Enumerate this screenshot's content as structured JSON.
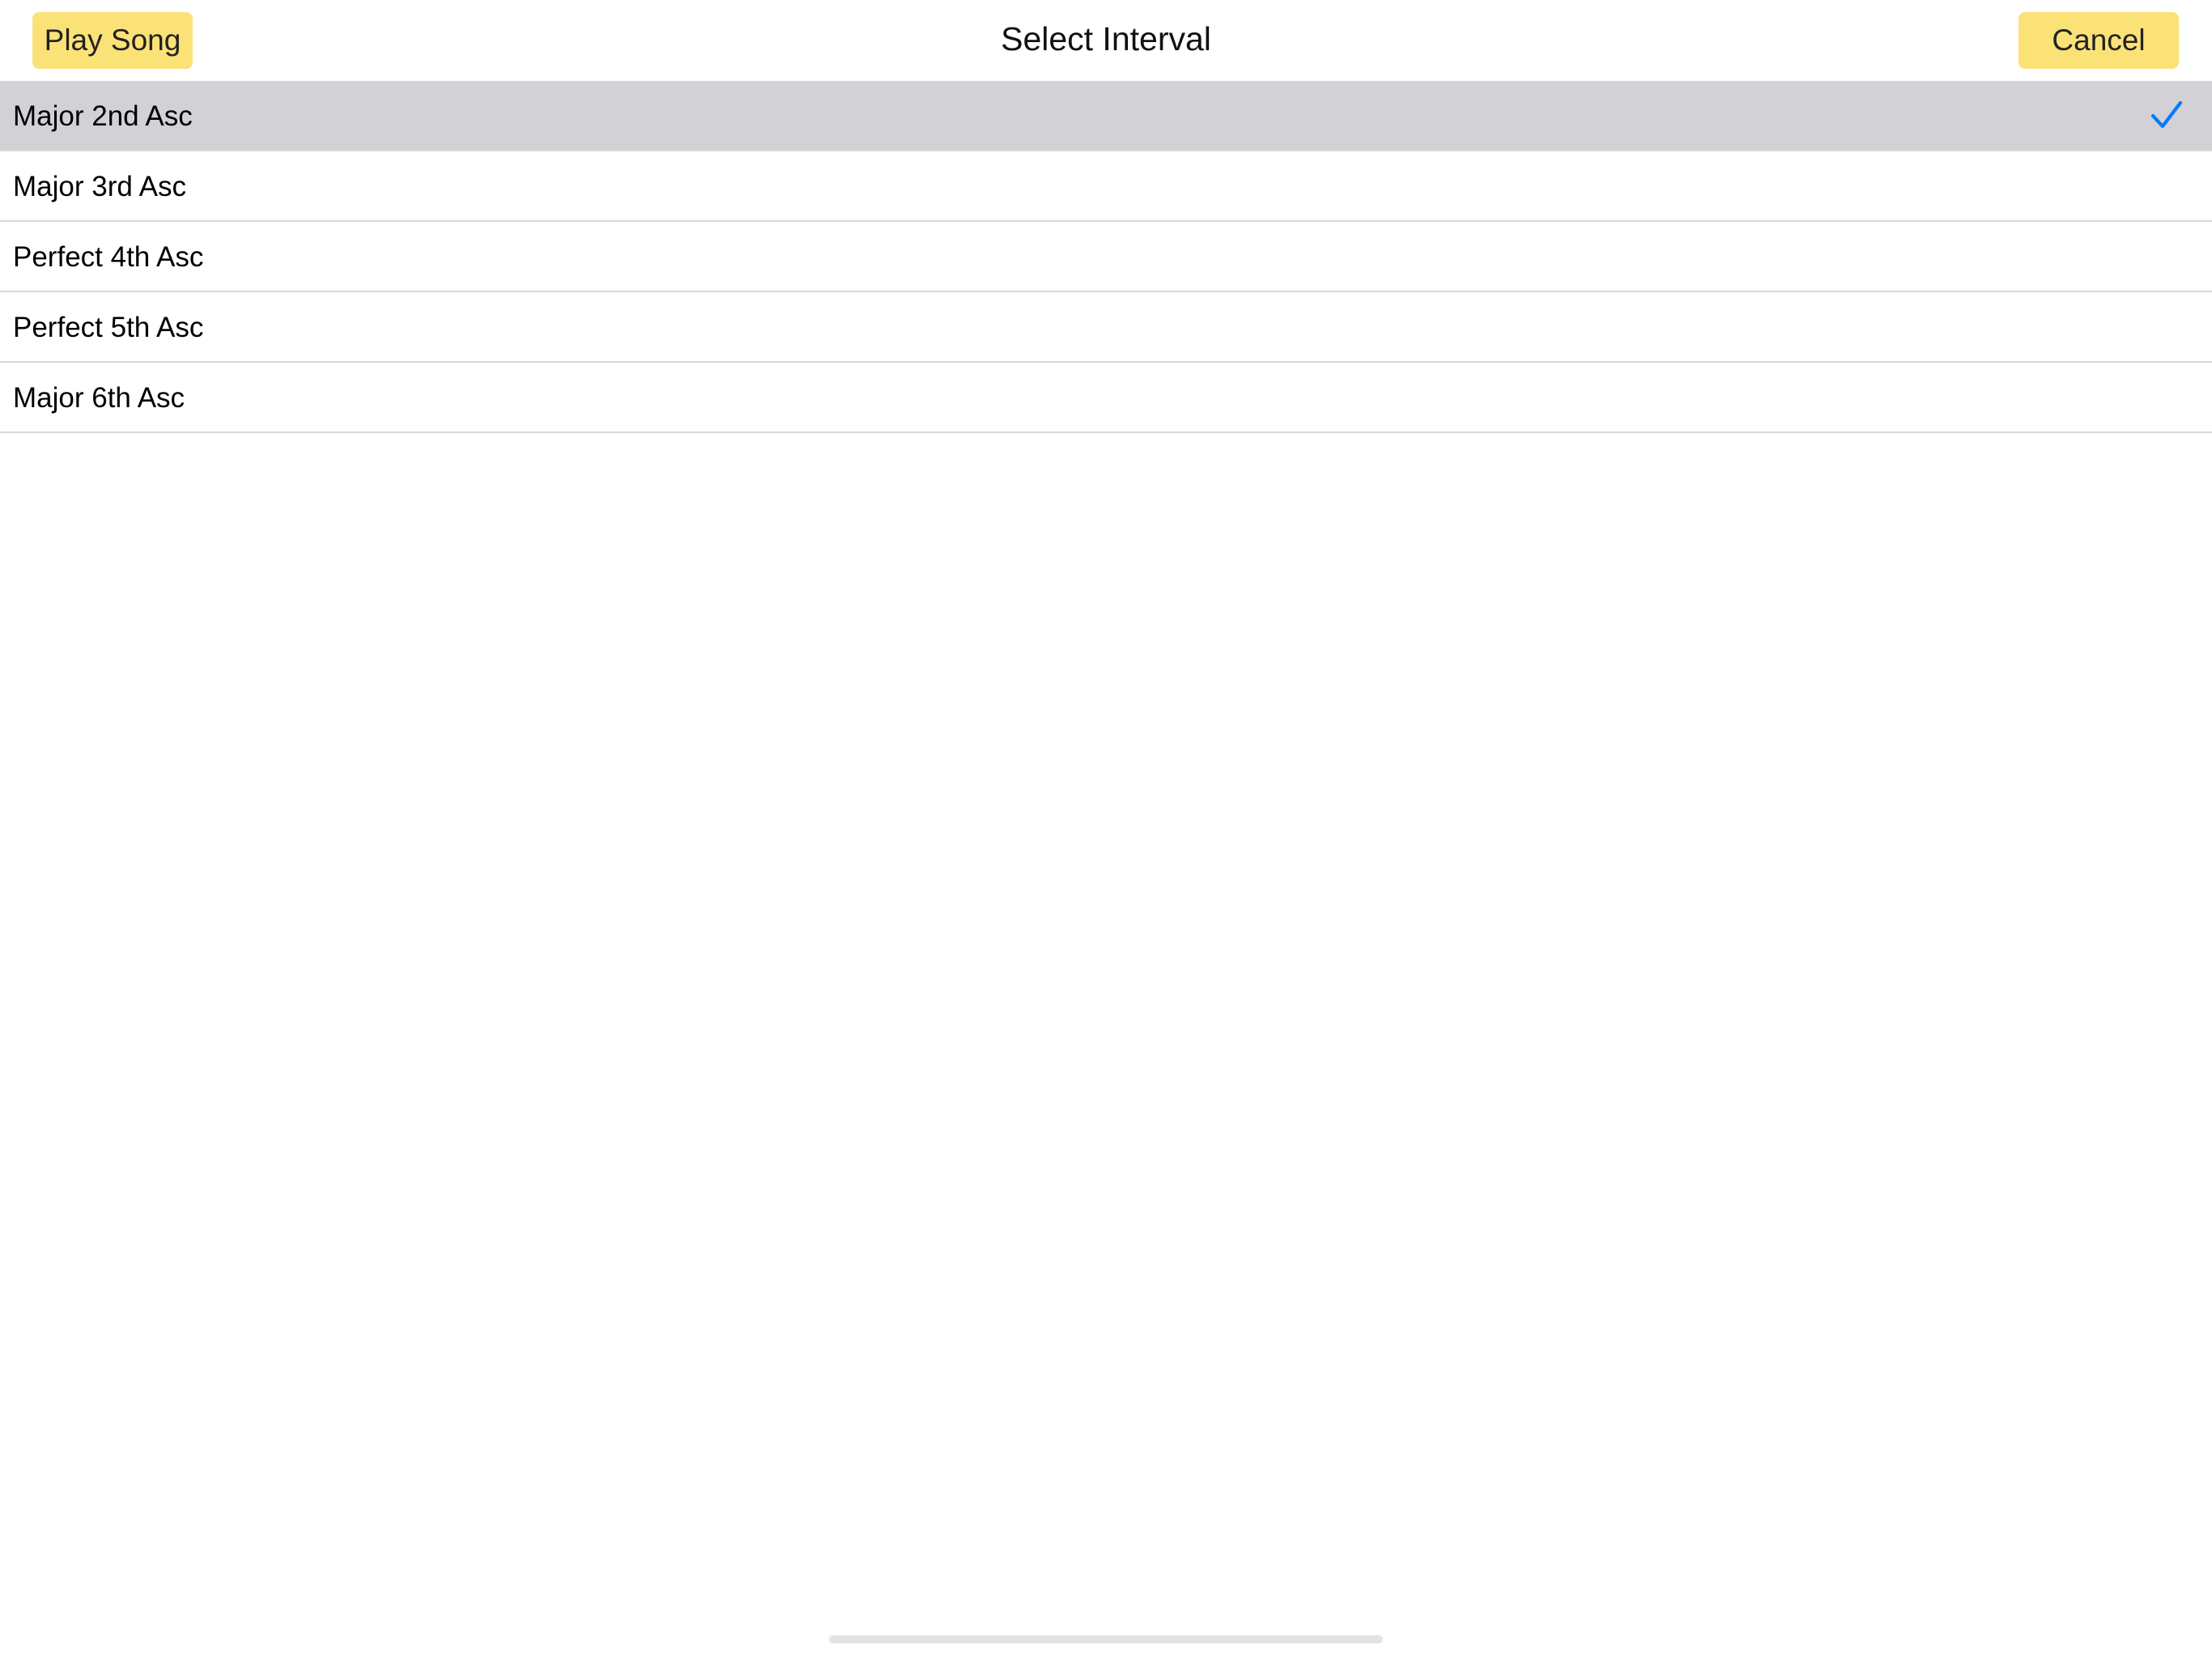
{
  "navigation": {
    "title": "Select Interval",
    "left_button": "Play Song",
    "right_button": "Cancel"
  },
  "intervals": [
    {
      "label": "Major 2nd Asc",
      "selected": true,
      "icon": "checkmark-icon"
    },
    {
      "label": "Major 3rd Asc",
      "selected": false
    },
    {
      "label": "Perfect 4th Asc",
      "selected": false
    },
    {
      "label": "Perfect 5th Asc",
      "selected": false
    },
    {
      "label": "Major 6th Asc",
      "selected": false
    }
  ],
  "colors": {
    "button_background": "#fbe277",
    "selected_row": "#d1d1d6",
    "checkmark": "#007aff",
    "separator": "#d9d9dc"
  }
}
